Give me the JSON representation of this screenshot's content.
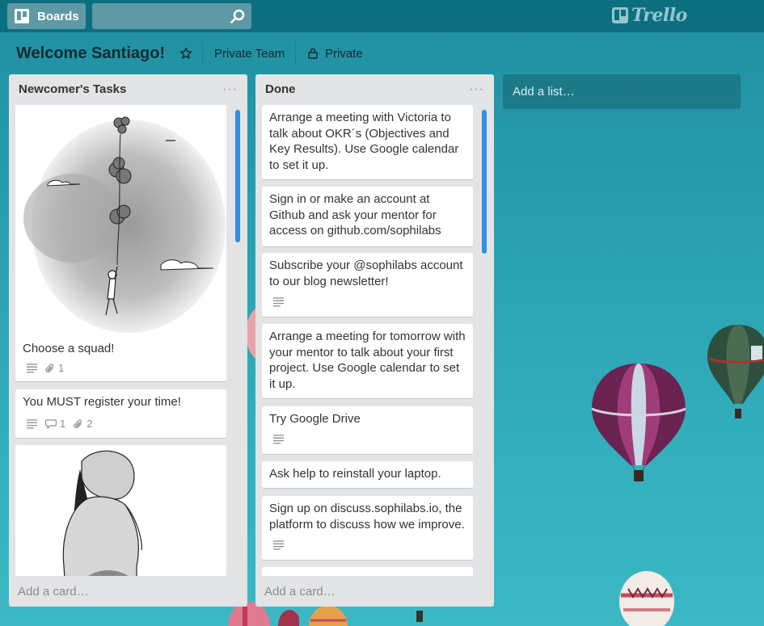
{
  "header": {
    "boards_label": "Boards",
    "search_placeholder": "",
    "logo_text": "Trello"
  },
  "board": {
    "title": "Welcome Santiago!",
    "team": "Private Team",
    "visibility": "Private"
  },
  "lists": [
    {
      "title": "Newcomer's Tasks",
      "menu": "···",
      "add_card": "Add a card…",
      "cards": [
        {
          "text": "Choose a squad!",
          "has_image": true,
          "image": "balloon-child-sketch",
          "description": true,
          "attachments": "1"
        },
        {
          "text": "You MUST register your time!",
          "description": true,
          "comments": "1",
          "attachments": "2"
        },
        {
          "text": "",
          "has_image": true,
          "image": "girl-sketch"
        }
      ]
    },
    {
      "title": "Done",
      "menu": "···",
      "add_card": "Add a card…",
      "cards": [
        {
          "text": "Arrange a meeting with Victoria to talk about OKR´s (Objectives and Key Results). Use Google calendar to set it up."
        },
        {
          "text": "Sign in or make an account at Github and ask your mentor for access on github.com/sophilabs"
        },
        {
          "text": "Subscribe your @sophilabs account to our blog newsletter!",
          "description": true
        },
        {
          "text": "Arrange a meeting for tomorrow with your mentor to talk about your first project. Use Google calendar to set it up."
        },
        {
          "text": "Try Google Drive",
          "description": true
        },
        {
          "text": "Ask help to reinstall your laptop."
        },
        {
          "text": "Sign up on discuss.sophilabs.io, the platform to discuss how we improve.",
          "description": true
        }
      ]
    }
  ],
  "add_list": "Add a list…",
  "colors": {
    "header": "#0c6f80",
    "background": "#2aa1b1",
    "list": "#e2e4e6",
    "scroll_thumb": "#2f8fe1"
  }
}
